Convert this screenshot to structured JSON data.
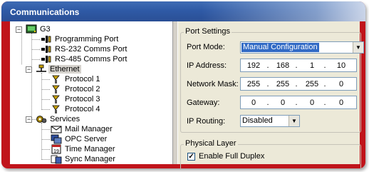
{
  "window": {
    "title": "Communications"
  },
  "tree": {
    "root": "G3",
    "items": [
      {
        "label": "Programming Port",
        "icon": "port-icon"
      },
      {
        "label": "RS-232 Comms Port",
        "icon": "port-icon"
      },
      {
        "label": "RS-485 Comms Port",
        "icon": "port-icon"
      },
      {
        "label": "Ethernet",
        "icon": "ethernet-icon",
        "selected": true
      },
      {
        "label": "Protocol 1",
        "icon": "protocol-icon"
      },
      {
        "label": "Protocol 2",
        "icon": "protocol-icon"
      },
      {
        "label": "Protocol 3",
        "icon": "protocol-icon"
      },
      {
        "label": "Protocol 4",
        "icon": "protocol-icon"
      },
      {
        "label": "Services",
        "icon": "services-icon"
      },
      {
        "label": "Mail Manager",
        "icon": "mail-icon"
      },
      {
        "label": "OPC Server",
        "icon": "opc-icon"
      },
      {
        "label": "Time Manager",
        "icon": "time-icon"
      },
      {
        "label": "Sync Manager",
        "icon": "sync-icon"
      }
    ]
  },
  "port_settings": {
    "group_title": "Port Settings",
    "port_mode_label": "Port Mode:",
    "port_mode_value": "Manual Configuration",
    "ip_address_label": "IP Address:",
    "ip_address": [
      "192",
      "168",
      "1",
      "10"
    ],
    "network_mask_label": "Network Mask:",
    "network_mask": [
      "255",
      "255",
      "255",
      "0"
    ],
    "gateway_label": "Gateway:",
    "gateway": [
      "0",
      "0",
      "0",
      "0"
    ],
    "ip_routing_label": "IP Routing:",
    "ip_routing_value": "Disabled",
    "dot": "."
  },
  "physical_layer": {
    "group_title": "Physical Layer",
    "full_duplex_label": "Enable Full Duplex",
    "full_duplex_checked": true,
    "check_mark": "✓"
  },
  "glyphs": {
    "minus": "−",
    "dropdown": "▼"
  }
}
